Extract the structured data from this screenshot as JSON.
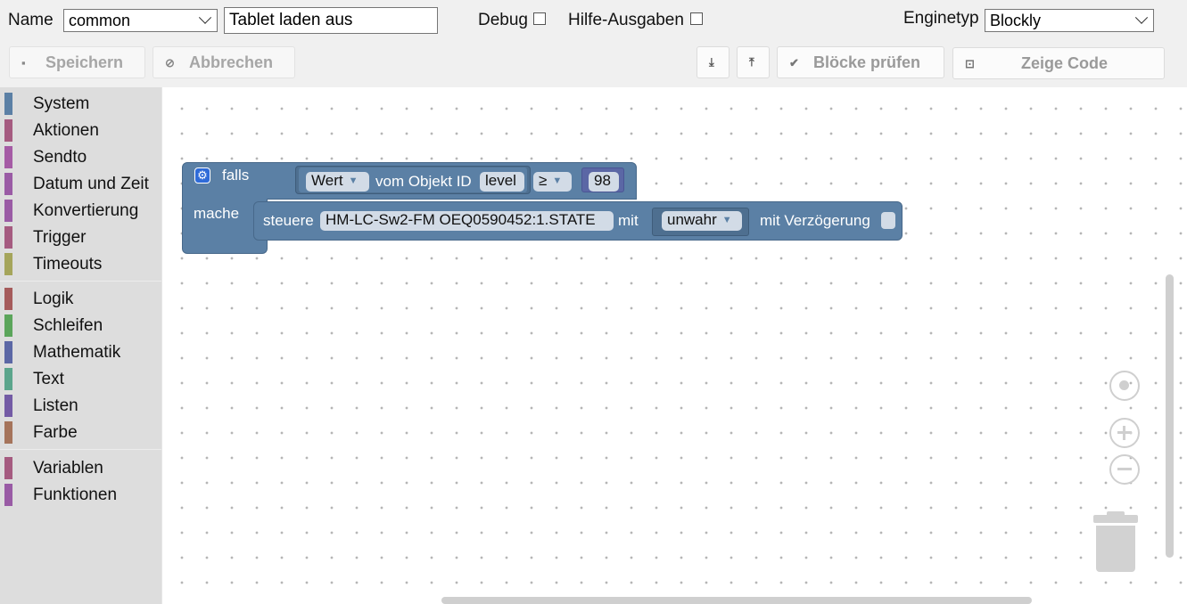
{
  "header": {
    "name_label": "Name",
    "name_select": "common",
    "script_name": "Tablet laden aus",
    "debug_label": "Debug",
    "help_label": "Hilfe-Ausgaben",
    "engine_label": "Enginetyp",
    "engine_select": "Blockly"
  },
  "toolbar": {
    "save_label": "Speichern",
    "cancel_label": "Abbrechen",
    "check_label": "Blöcke prüfen",
    "show_code_label": "Zeige Code",
    "export_icon": "⤓",
    "import_icon": "⤒"
  },
  "sidebar": {
    "items": [
      {
        "label": "System",
        "color": "#5b80a5"
      },
      {
        "label": "Aktionen",
        "color": "#a55b80"
      },
      {
        "label": "Sendto",
        "color": "#a55ba5"
      },
      {
        "label": "Datum und Zeit",
        "color": "#9a5ba5"
      },
      {
        "label": "Konvertierung",
        "color": "#9a5ba5"
      },
      {
        "label": "Trigger",
        "color": "#a55b80"
      },
      {
        "label": "Timeouts",
        "color": "#a5a55b"
      },
      {
        "label": "Logik",
        "color": "#a55b5b"
      },
      {
        "label": "Schleifen",
        "color": "#5ba55b"
      },
      {
        "label": "Mathematik",
        "color": "#5b67a5"
      },
      {
        "label": "Text",
        "color": "#5ba58c"
      },
      {
        "label": "Listen",
        "color": "#745ba5"
      },
      {
        "label": "Farbe",
        "color": "#a5745b"
      },
      {
        "label": "Variablen",
        "color": "#a55b80"
      },
      {
        "label": "Funktionen",
        "color": "#995ba5"
      }
    ]
  },
  "blocks": {
    "if_label": "falls",
    "do_label": "mache",
    "value_dropdown": "Wert",
    "of_object_label": "vom Objekt ID",
    "object_id": "level",
    "operator": "≥",
    "number": "98",
    "control_label": "steuere",
    "state_id": "HM-LC-Sw2-FM OEQ0590452:1.STATE",
    "with_label": "mit",
    "bool_value": "unwahr",
    "delay_label": "mit Verzögerung",
    "gear_icon": "⚙"
  }
}
